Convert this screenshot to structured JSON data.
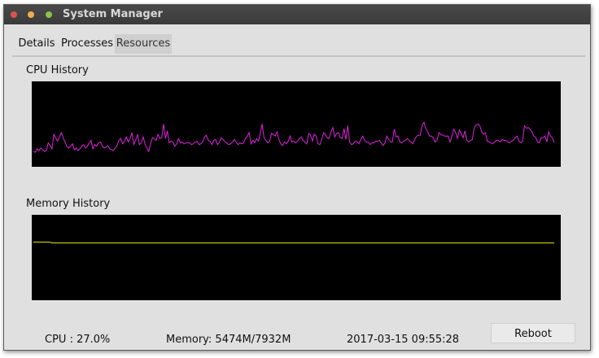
{
  "window": {
    "title": "System Manager"
  },
  "tabs": [
    {
      "label": "Details"
    },
    {
      "label": "Processes"
    },
    {
      "label": "Resources"
    }
  ],
  "active_tab": "Resources",
  "cpu_section": {
    "title": "CPU History",
    "line_color": "#e020e0",
    "history": [
      18,
      17,
      21,
      19,
      22,
      20,
      18,
      19,
      28,
      25,
      21,
      38,
      34,
      30,
      35,
      40,
      34,
      29,
      24,
      22,
      24,
      27,
      20,
      22,
      19,
      21,
      24,
      26,
      22,
      24,
      28,
      31,
      21,
      26,
      24,
      28,
      29,
      25,
      22,
      23,
      25,
      21,
      20,
      19,
      22,
      25,
      31,
      33,
      27,
      30,
      35,
      29,
      33,
      40,
      26,
      31,
      38,
      26,
      28,
      35,
      27,
      22,
      18,
      27,
      34,
      33,
      31,
      38,
      33,
      34,
      50,
      33,
      42,
      28,
      30,
      29,
      24,
      27,
      33,
      28,
      29,
      27,
      28,
      28,
      28,
      26,
      27,
      29,
      30,
      26,
      27,
      29,
      35,
      37,
      31,
      30,
      26,
      31,
      32,
      26,
      29,
      34,
      32,
      29,
      28,
      26,
      27,
      29,
      32,
      29,
      26,
      28,
      27,
      28,
      33,
      36,
      40,
      27,
      31,
      28,
      33,
      30,
      39,
      50,
      34,
      31,
      28,
      30,
      39,
      38,
      36,
      41,
      32,
      27,
      25,
      29,
      27,
      30,
      36,
      29,
      30,
      28,
      30,
      33,
      35,
      31,
      29,
      27,
      39,
      37,
      30,
      38,
      36,
      27,
      26,
      32,
      40,
      38,
      34,
      33,
      41,
      46,
      35,
      39,
      40,
      34,
      33,
      45,
      32,
      48,
      29,
      26,
      27,
      30,
      29,
      27,
      32,
      36,
      31,
      29,
      29,
      26,
      28,
      28,
      30,
      30,
      31,
      28,
      25,
      28,
      36,
      32,
      29,
      29,
      44,
      35,
      36,
      29,
      28,
      30,
      31,
      33,
      31,
      29,
      27,
      32,
      36,
      37,
      37,
      49,
      52,
      44,
      41,
      36,
      36,
      34,
      29,
      31,
      40,
      38,
      37,
      36,
      36,
      36,
      29,
      36,
      44,
      40,
      33,
      43,
      39,
      34,
      42,
      31,
      29,
      31,
      32,
      46,
      49,
      50,
      48,
      41,
      38,
      40,
      30,
      29,
      28,
      27,
      29,
      31,
      31,
      29,
      32,
      31,
      31,
      29,
      28,
      30,
      31,
      34,
      36,
      30,
      28,
      30,
      48,
      45,
      46,
      44,
      41,
      36,
      35,
      29,
      28,
      34,
      34,
      36,
      29,
      41,
      36,
      34,
      28
    ],
    "y_max": 100
  },
  "memory_section": {
    "title": "Memory History",
    "line_color": "#e8f000",
    "history": [
      68,
      68,
      68,
      68,
      68,
      68,
      68,
      68,
      68,
      68,
      67,
      67,
      67,
      67,
      67,
      67,
      67,
      67,
      67,
      67,
      67,
      67,
      67,
      67,
      67,
      67,
      67,
      67,
      67,
      67,
      67,
      67,
      67,
      67,
      67,
      67,
      67,
      67,
      67,
      67,
      67,
      67,
      67,
      67,
      67,
      67,
      67,
      67,
      67,
      67,
      67,
      67,
      67,
      67,
      67,
      67,
      67,
      67,
      67,
      67,
      67,
      67,
      67,
      67,
      67,
      67,
      67,
      67,
      67,
      67,
      67,
      67,
      67,
      67,
      67,
      67,
      67,
      67,
      67,
      67,
      67,
      67,
      67,
      67,
      67,
      67,
      67,
      67,
      67,
      67,
      67,
      67,
      67,
      67,
      67,
      67,
      67,
      67,
      67,
      67,
      67,
      67,
      67,
      67,
      67,
      67,
      67,
      67,
      67,
      67,
      67,
      67,
      67,
      67,
      67,
      67,
      67,
      67,
      67,
      67,
      67,
      67,
      67,
      67,
      67,
      67,
      67,
      67,
      67,
      67,
      67,
      67,
      67,
      67,
      67,
      67,
      67,
      67,
      67,
      67,
      67,
      67,
      67,
      67,
      67,
      67,
      67,
      67,
      67,
      67,
      67,
      67,
      67,
      67,
      67,
      67,
      67,
      67,
      67,
      67,
      67,
      67,
      67,
      67,
      67,
      67,
      67,
      67,
      67,
      67,
      67,
      67,
      67,
      67,
      67,
      67,
      67,
      67,
      67,
      67,
      67,
      67,
      67,
      67,
      67,
      67,
      67,
      67,
      67,
      67,
      67,
      67,
      67,
      67,
      67,
      67,
      67,
      67,
      67,
      67,
      67,
      67,
      67,
      67,
      67,
      67,
      67,
      67,
      67,
      67,
      67,
      67,
      67,
      67,
      67,
      67,
      67,
      67,
      67,
      67,
      67,
      67,
      67,
      67,
      67,
      67,
      67,
      67,
      67,
      67,
      67,
      67,
      67,
      67,
      67,
      67,
      67,
      67,
      67,
      67,
      67,
      67,
      67,
      67,
      67,
      67,
      67,
      67,
      67,
      67,
      67,
      67,
      67,
      67,
      67,
      67,
      67,
      67,
      67,
      67,
      67,
      67,
      67,
      67,
      67,
      67,
      67,
      67,
      67,
      67,
      67,
      67,
      67,
      67,
      67,
      67,
      67,
      67,
      67,
      67,
      67,
      67
    ],
    "y_max": 100
  },
  "status": {
    "cpu": "CPU : 27.0%",
    "memory": "Memory: 5474M/7932M",
    "datetime": "2017-03-15 09:55:28"
  },
  "buttons": {
    "reboot": "Reboot"
  }
}
